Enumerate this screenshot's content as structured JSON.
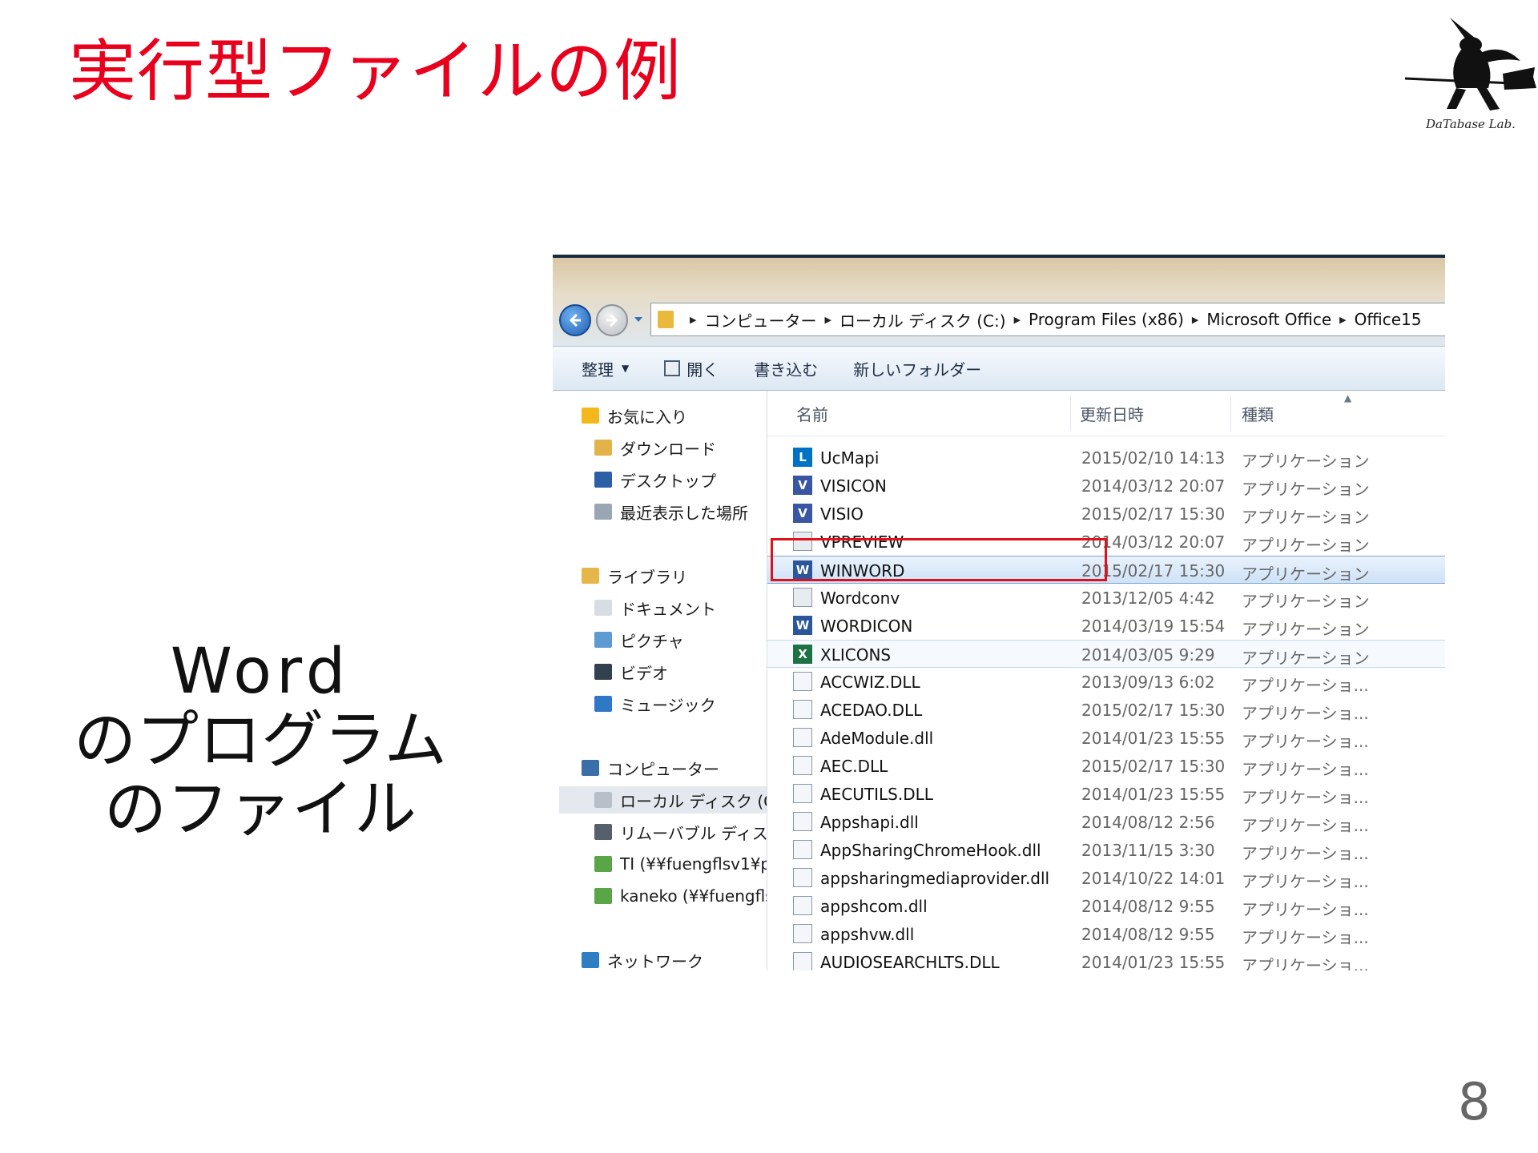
{
  "slide": {
    "title": "実行型ファイルの例",
    "caption_line1": "Word",
    "caption_line2": "のプログラム",
    "caption_line3": "のファイル",
    "page_number": "8",
    "logo_text": "DaTabase Lab."
  },
  "explorer": {
    "breadcrumbs": [
      "コンピューター",
      "ローカル ディスク (C:)",
      "Program Files (x86)",
      "Microsoft Office",
      "Office15"
    ],
    "toolbar": {
      "organize": "整理",
      "open": "開く",
      "burn": "書き込む",
      "new_folder": "新しいフォルダー"
    },
    "nav": [
      {
        "label": "お気に入り",
        "icon": "star-icon"
      },
      {
        "label": "ダウンロード",
        "icon": "download-folder-icon"
      },
      {
        "label": "デスクトップ",
        "icon": "desktop-icon"
      },
      {
        "label": "最近表示した場所",
        "icon": "recent-places-icon"
      },
      {
        "label": "ライブラリ",
        "icon": "library-icon"
      },
      {
        "label": "ドキュメント",
        "icon": "document-icon"
      },
      {
        "label": "ピクチャ",
        "icon": "picture-icon"
      },
      {
        "label": "ビデオ",
        "icon": "video-icon"
      },
      {
        "label": "ミュージック",
        "icon": "music-icon"
      },
      {
        "label": "コンピューター",
        "icon": "computer-icon"
      },
      {
        "label": "ローカル ディスク (C:)",
        "icon": "local-disk-icon"
      },
      {
        "label": "リムーバブル ディスク",
        "icon": "removable-disk-icon"
      },
      {
        "label": "TI (¥¥fuengflsv1¥p",
        "icon": "network-drive-icon"
      },
      {
        "label": "kaneko (¥¥fuengfls",
        "icon": "network-drive-icon"
      },
      {
        "label": "ネットワーク",
        "icon": "network-icon"
      }
    ],
    "columns": {
      "name": "名前",
      "date": "更新日時",
      "type": "種類"
    },
    "files": [
      {
        "name": "UcMapi",
        "date": "2015/02/10 14:13",
        "type": "アプリケーション",
        "icon": "lync-icon"
      },
      {
        "name": "VISICON",
        "date": "2014/03/12 20:07",
        "type": "アプリケーション",
        "icon": "visio-icon"
      },
      {
        "name": "VISIO",
        "date": "2015/02/17 15:30",
        "type": "アプリケーション",
        "icon": "visio-icon"
      },
      {
        "name": "VPREVIEW",
        "date": "2014/03/12 20:07",
        "type": "アプリケーション",
        "icon": "app-window-icon"
      },
      {
        "name": "WINWORD",
        "date": "2015/02/17 15:30",
        "type": "アプリケーション",
        "icon": "word-icon"
      },
      {
        "name": "Wordconv",
        "date": "2013/12/05 4:42",
        "type": "アプリケーション",
        "icon": "app-window-icon"
      },
      {
        "name": "WORDICON",
        "date": "2014/03/19 15:54",
        "type": "アプリケーション",
        "icon": "word-icon"
      },
      {
        "name": "XLICONS",
        "date": "2014/03/05 9:29",
        "type": "アプリケーション",
        "icon": "excel-icon"
      },
      {
        "name": "ACCWIZ.DLL",
        "date": "2013/09/13 6:02",
        "type": "アプリケーショ...",
        "icon": "dll-icon"
      },
      {
        "name": "ACEDAO.DLL",
        "date": "2015/02/17 15:30",
        "type": "アプリケーショ...",
        "icon": "dll-icon"
      },
      {
        "name": "AdeModule.dll",
        "date": "2014/01/23 15:55",
        "type": "アプリケーショ...",
        "icon": "dll-icon"
      },
      {
        "name": "AEC.DLL",
        "date": "2015/02/17 15:30",
        "type": "アプリケーショ...",
        "icon": "dll-icon"
      },
      {
        "name": "AECUTILS.DLL",
        "date": "2014/01/23 15:55",
        "type": "アプリケーショ...",
        "icon": "dll-icon"
      },
      {
        "name": "Appshapi.dll",
        "date": "2014/08/12 2:56",
        "type": "アプリケーショ...",
        "icon": "dll-icon"
      },
      {
        "name": "AppSharingChromeHook.dll",
        "date": "2013/11/15 3:30",
        "type": "アプリケーショ...",
        "icon": "dll-icon"
      },
      {
        "name": "appsharingmediaprovider.dll",
        "date": "2014/10/22 14:01",
        "type": "アプリケーショ...",
        "icon": "dll-icon"
      },
      {
        "name": "appshcom.dll",
        "date": "2014/08/12 9:55",
        "type": "アプリケーショ...",
        "icon": "dll-icon"
      },
      {
        "name": "appshvw.dll",
        "date": "2014/08/12 9:55",
        "type": "アプリケーショ...",
        "icon": "dll-icon"
      },
      {
        "name": "AUDIOSEARCHLTS.DLL",
        "date": "2014/01/23 15:55",
        "type": "アプリケーショ...",
        "icon": "dll-icon"
      }
    ],
    "selected_file": "WINWORD",
    "colors": {
      "highlight_box": "#e0111b",
      "title": "#e8001c",
      "word": "#2b579a",
      "excel": "#1e7145",
      "visio": "#3955a3",
      "lync": "#0072c6"
    }
  }
}
